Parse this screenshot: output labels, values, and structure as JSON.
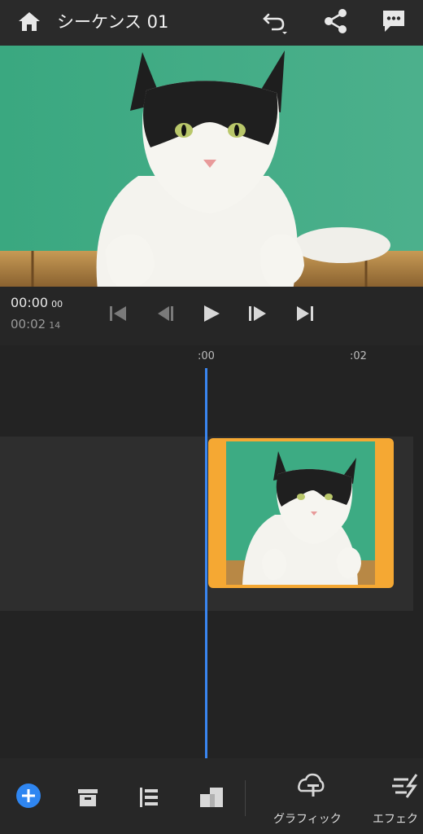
{
  "header": {
    "title": "シーケンス 01"
  },
  "transport": {
    "current_time": "00:00",
    "current_frames": "00",
    "duration_time": "00:02",
    "duration_frames": "14"
  },
  "timeline": {
    "ruler_labels": [
      ":00",
      ":02"
    ]
  },
  "toolbar": {
    "graphics_label": "グラフィック",
    "effects_label": "エフェク"
  },
  "colors": {
    "accent": "#2f86f1",
    "clip_border": "#f5a833",
    "playhead": "#3a86f0"
  }
}
